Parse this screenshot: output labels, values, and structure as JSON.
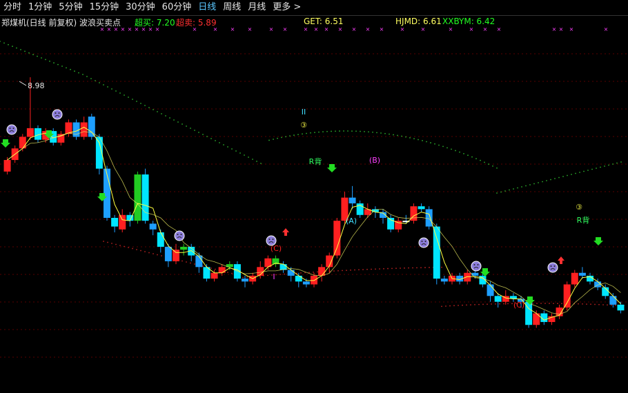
{
  "toolbar": {
    "tabs": [
      "分时",
      "1分钟",
      "5分钟",
      "15分钟",
      "30分钟",
      "60分钟",
      "日线",
      "周线",
      "月线",
      "更多 >"
    ],
    "active": 6
  },
  "info": {
    "title": "郑煤机(日线 前复权) 波浪买卖点",
    "buy_label": "超买: 7.20",
    "sell_label": "超卖: 5.89",
    "get_label": "GET: 6.51",
    "hjmd_label": "HJMD: 6.61",
    "xxbym_label": "XXBYM: 6.42"
  },
  "colors": {
    "up": "#ff2020",
    "down": "#1e9fff",
    "down_light": "#00e5ff",
    "green": "#22cc22",
    "ma": "#ffff40",
    "grid": "#5a0000",
    "dot_green": "#2aa82a",
    "dot_red": "#b82020",
    "magenta": "#ff40ff",
    "cyan": "#40e0ff"
  },
  "chart_data": {
    "type": "candlestick",
    "annotations": {
      "max_price": "8.98",
      "wave_labels": [
        "II",
        "③",
        "R背",
        "(B)",
        "(A)",
        "(C)",
        "I",
        "(C)",
        "③",
        "R背"
      ]
    },
    "candles": [
      [
        7.35,
        7.55,
        7.6,
        7.3,
        "up"
      ],
      [
        7.55,
        7.75,
        7.8,
        7.5,
        "up"
      ],
      [
        7.75,
        7.95,
        8.0,
        7.7,
        "up"
      ],
      [
        7.95,
        8.1,
        8.98,
        7.9,
        "up"
      ],
      [
        8.1,
        7.9,
        8.15,
        7.85,
        "down"
      ],
      [
        7.9,
        8.05,
        8.1,
        7.85,
        "up"
      ],
      [
        8.05,
        7.85,
        8.1,
        7.8,
        "down"
      ],
      [
        7.85,
        8.0,
        8.05,
        7.8,
        "up"
      ],
      [
        8.0,
        8.2,
        8.25,
        7.95,
        "up"
      ],
      [
        8.2,
        7.95,
        8.25,
        7.9,
        "down"
      ],
      [
        7.95,
        8.2,
        8.3,
        7.9,
        "up"
      ],
      [
        8.3,
        7.95,
        8.35,
        7.9,
        "down"
      ],
      [
        7.95,
        7.4,
        8.0,
        7.3,
        "down"
      ],
      [
        7.4,
        6.55,
        7.45,
        6.5,
        "down"
      ],
      [
        6.55,
        6.4,
        6.6,
        6.3,
        "down"
      ],
      [
        6.35,
        6.6,
        6.7,
        6.3,
        "up"
      ],
      [
        6.6,
        6.5,
        6.65,
        6.4,
        "down"
      ],
      [
        6.5,
        7.3,
        7.35,
        6.45,
        "green"
      ],
      [
        7.3,
        6.5,
        7.4,
        6.45,
        "down"
      ],
      [
        6.45,
        6.35,
        6.5,
        6.25,
        "down"
      ],
      [
        6.3,
        6.05,
        6.35,
        5.95,
        "down"
      ],
      [
        6.05,
        5.8,
        6.1,
        5.7,
        "down"
      ],
      [
        5.8,
        6.0,
        6.1,
        5.75,
        "up"
      ],
      [
        6.0,
        6.05,
        6.1,
        5.9,
        "green"
      ],
      [
        6.05,
        5.9,
        6.1,
        5.8,
        "down"
      ],
      [
        5.9,
        5.7,
        5.95,
        5.6,
        "down"
      ],
      [
        5.7,
        5.5,
        5.75,
        5.45,
        "down"
      ],
      [
        5.5,
        5.6,
        5.65,
        5.45,
        "up"
      ],
      [
        5.6,
        5.7,
        5.75,
        5.55,
        "up"
      ],
      [
        5.7,
        5.75,
        5.8,
        5.65,
        "green"
      ],
      [
        5.75,
        5.5,
        5.8,
        5.45,
        "down"
      ],
      [
        5.5,
        5.45,
        5.55,
        5.35,
        "down"
      ],
      [
        5.45,
        5.55,
        5.6,
        5.4,
        "up"
      ],
      [
        5.55,
        5.7,
        5.8,
        5.5,
        "up"
      ],
      [
        5.7,
        5.85,
        5.9,
        5.65,
        "up"
      ],
      [
        5.85,
        5.75,
        5.9,
        5.7,
        "green"
      ],
      [
        5.75,
        5.65,
        5.8,
        5.6,
        "down"
      ],
      [
        5.65,
        5.55,
        5.7,
        5.45,
        "down"
      ],
      [
        5.55,
        5.45,
        5.6,
        5.35,
        "down"
      ],
      [
        5.45,
        5.4,
        5.5,
        5.35,
        "down"
      ],
      [
        5.4,
        5.55,
        5.6,
        5.35,
        "up"
      ],
      [
        5.55,
        5.7,
        5.75,
        5.45,
        "up"
      ],
      [
        5.7,
        5.9,
        5.95,
        5.6,
        "up"
      ],
      [
        5.9,
        6.5,
        6.55,
        5.85,
        "up"
      ],
      [
        6.5,
        6.9,
        7.0,
        6.45,
        "up"
      ],
      [
        6.9,
        6.8,
        7.1,
        6.7,
        "down"
      ],
      [
        6.8,
        6.6,
        6.85,
        6.55,
        "down"
      ],
      [
        6.6,
        6.7,
        6.8,
        6.55,
        "up"
      ],
      [
        6.7,
        6.65,
        6.75,
        6.55,
        "down"
      ],
      [
        6.65,
        6.55,
        6.7,
        6.45,
        "down"
      ],
      [
        6.55,
        6.35,
        6.6,
        6.3,
        "down"
      ],
      [
        6.35,
        6.5,
        6.55,
        6.3,
        "up"
      ],
      [
        6.5,
        6.5,
        6.6,
        6.45,
        "doji"
      ],
      [
        6.5,
        6.75,
        6.8,
        6.45,
        "up"
      ],
      [
        6.75,
        6.7,
        6.8,
        6.65,
        "down"
      ],
      [
        6.7,
        6.4,
        6.75,
        6.35,
        "down"
      ],
      [
        6.4,
        5.5,
        6.45,
        5.4,
        "down"
      ],
      [
        5.5,
        5.45,
        5.55,
        5.4,
        "down"
      ],
      [
        5.45,
        5.55,
        5.6,
        5.4,
        "up"
      ],
      [
        5.55,
        5.45,
        5.6,
        5.4,
        "down"
      ],
      [
        5.45,
        5.6,
        5.65,
        5.4,
        "up"
      ],
      [
        5.6,
        5.55,
        5.65,
        5.5,
        "down"
      ],
      [
        5.55,
        5.4,
        5.6,
        5.35,
        "down"
      ],
      [
        5.4,
        5.2,
        5.45,
        5.1,
        "down"
      ],
      [
        5.2,
        5.1,
        5.25,
        5.0,
        "down"
      ],
      [
        5.1,
        5.2,
        5.3,
        5.05,
        "up"
      ],
      [
        5.2,
        5.15,
        5.25,
        5.1,
        "down"
      ],
      [
        5.15,
        5.1,
        5.2,
        5.0,
        "down"
      ],
      [
        5.1,
        4.7,
        5.15,
        4.65,
        "down"
      ],
      [
        4.7,
        4.9,
        4.95,
        4.65,
        "up"
      ],
      [
        4.9,
        4.75,
        4.95,
        4.7,
        "down"
      ],
      [
        4.75,
        4.85,
        4.9,
        4.7,
        "up"
      ],
      [
        4.85,
        5.0,
        5.05,
        4.8,
        "up"
      ],
      [
        5.0,
        5.4,
        5.45,
        4.95,
        "up"
      ],
      [
        5.4,
        5.6,
        5.65,
        5.35,
        "up"
      ],
      [
        5.6,
        5.55,
        5.7,
        5.5,
        "down"
      ],
      [
        5.55,
        5.45,
        5.6,
        5.4,
        "down"
      ],
      [
        5.45,
        5.35,
        5.5,
        5.3,
        "down"
      ],
      [
        5.35,
        5.2,
        5.4,
        5.15,
        "down"
      ],
      [
        5.2,
        5.05,
        5.25,
        5.0,
        "down"
      ],
      [
        5.05,
        4.95,
        5.1,
        4.9,
        "down"
      ]
    ]
  }
}
